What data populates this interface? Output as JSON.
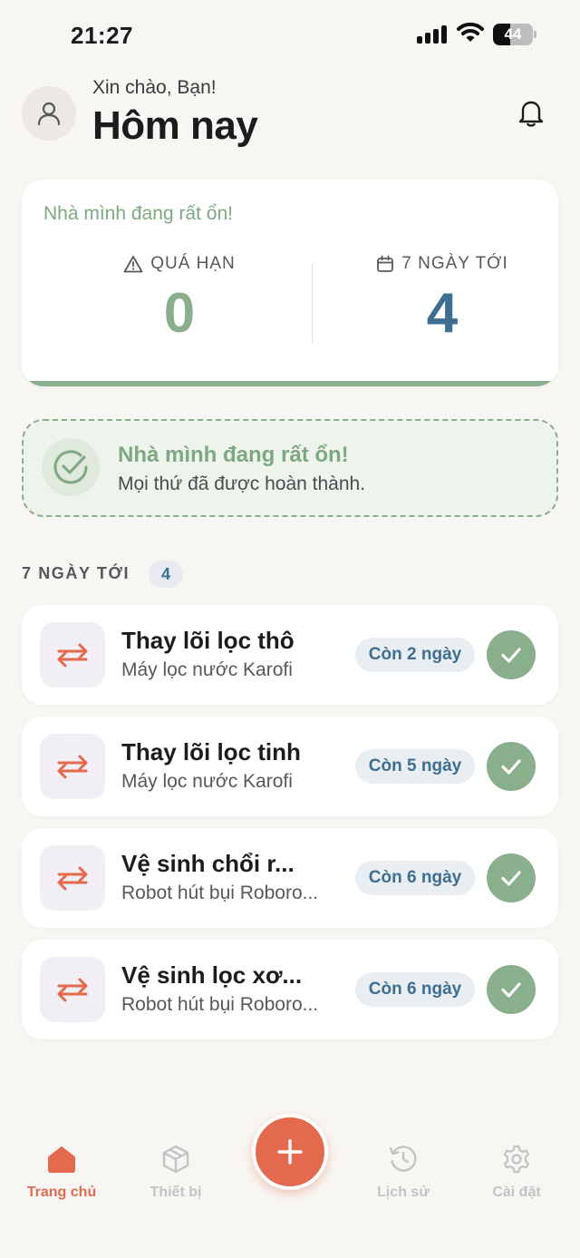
{
  "status_bar": {
    "time": "21:27",
    "battery_level": "44",
    "icons": [
      "cellular-signal-icon",
      "wifi-icon",
      "battery-icon"
    ]
  },
  "header": {
    "greeting": "Xin chào, Bạn!",
    "title": "Hôm nay",
    "icons": [
      "user-icon",
      "bell-icon"
    ]
  },
  "summary": {
    "message": "Nhà mình đang rất ổn!",
    "overdue_label": "QUÁ HẠN",
    "overdue_value": "0",
    "week_label": "7 NGÀY TỚI",
    "week_value": "4"
  },
  "banner": {
    "title": "Nhà mình đang rất ổn!",
    "subtitle": "Mọi thứ đã được hoàn thành."
  },
  "upcoming": {
    "section_title": "7 NGÀY TỚI",
    "count": "4",
    "tasks": [
      {
        "title": "Thay lõi lọc thô",
        "device": "Máy lọc nước Karofi",
        "due": "Còn 2 ngày"
      },
      {
        "title": "Thay lõi lọc tinh",
        "device": "Máy lọc nước Karofi",
        "due": "Còn 5 ngày"
      },
      {
        "title": "Vệ sinh chổi r...",
        "device": "Robot hút bụi Roboro...",
        "due": "Còn 6 ngày"
      },
      {
        "title": "Vệ sinh lọc xơ...",
        "device": "Robot hút bụi Roboro...",
        "due": "Còn 6 ngày"
      }
    ]
  },
  "nav": {
    "home": "Trang chủ",
    "devices": "Thiết bị",
    "history": "Lịch sử",
    "settings": "Cài đặt"
  },
  "colors": {
    "background": "#f8f6f2",
    "green": "#8aaf8c",
    "blue": "#3e6f93",
    "accent": "#e36a4e"
  }
}
